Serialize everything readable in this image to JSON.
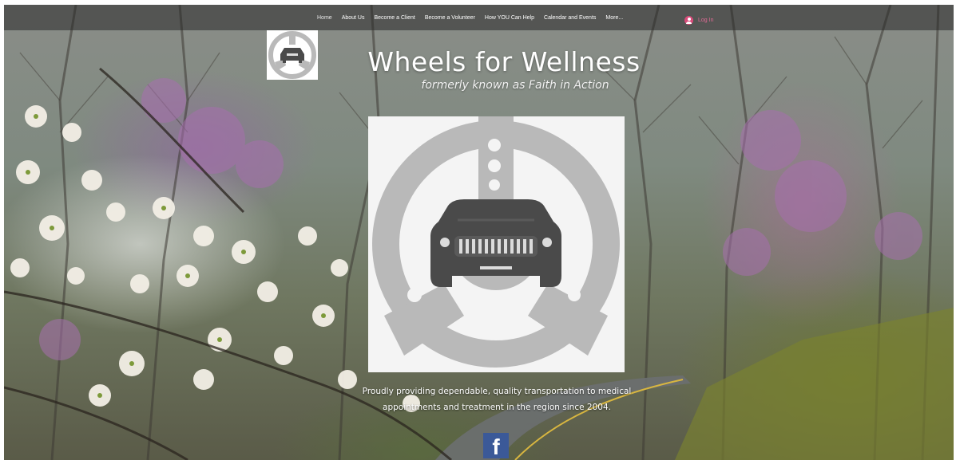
{
  "nav": {
    "items": [
      "Home",
      "About Us",
      "Become a Client",
      "Become a Volunteer",
      "How YOU Can Help",
      "Calendar and Events",
      "More..."
    ],
    "login_label": "Log In"
  },
  "hero": {
    "title": "Wheels for Wellness",
    "subtitle": "formerly known as Faith in Action",
    "tagline_line1": "Proudly providing dependable, quality transportation to medical",
    "tagline_line2": "appointments and treatment in the region since 2004."
  },
  "social": {
    "facebook_glyph": "f"
  },
  "colors": {
    "nav_bar": "#282828",
    "login_accent": "#e06b95",
    "facebook_blue": "#3b5998",
    "logo_gray": "#b9b9b9",
    "car_dark": "#4a4a4a"
  },
  "icons": {
    "login": "user-circle-icon",
    "facebook": "facebook-icon",
    "logo": "steering-wheel-car-logo"
  }
}
